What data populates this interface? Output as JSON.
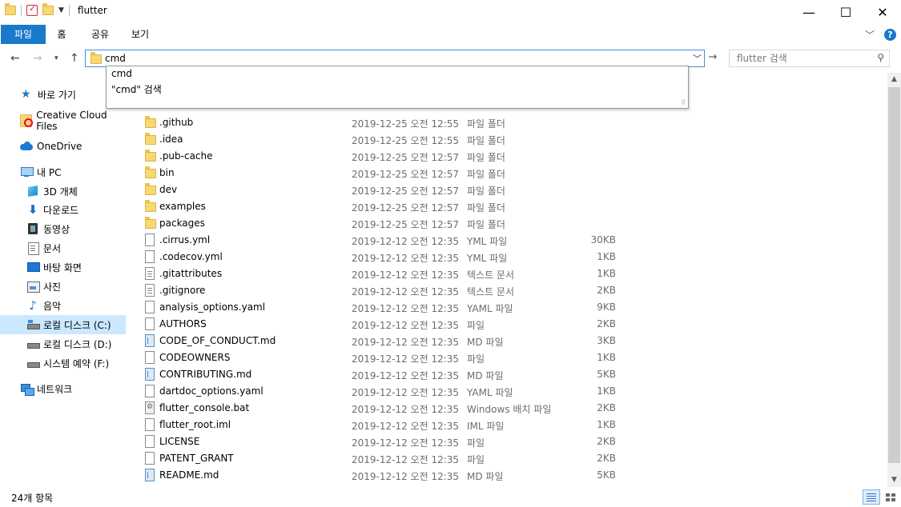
{
  "window": {
    "title": "flutter",
    "minimize_glyph": "—",
    "maximize_glyph": "☐",
    "close_glyph": "✕"
  },
  "ribbon": {
    "tabs": [
      "파일",
      "홈",
      "공유",
      "보기"
    ],
    "help_glyph": "?"
  },
  "address": {
    "value": "cmd",
    "go_glyph": "→"
  },
  "search": {
    "placeholder": "flutter 검색"
  },
  "suggestions": [
    "cmd",
    "\"cmd\" 검색"
  ],
  "nav": {
    "quick_access": "바로 가기",
    "creative_cloud": "Creative Cloud Files",
    "onedrive": "OneDrive",
    "this_pc": "내 PC",
    "objects3d": "3D 개체",
    "downloads": "다운로드",
    "videos": "동영상",
    "documents": "문서",
    "desktop": "바탕 화면",
    "pictures": "사진",
    "music": "음악",
    "drive_c": "로컬 디스크 (C:)",
    "drive_d": "로컬 디스크 (D:)",
    "drive_f": "시스템 예약 (F:)",
    "network": "네트워크"
  },
  "files": [
    {
      "name": ".github",
      "date": "2019-12-25 오전 12:55",
      "type": "파일 폴더",
      "size": "",
      "icon": "folder"
    },
    {
      "name": ".idea",
      "date": "2019-12-25 오전 12:55",
      "type": "파일 폴더",
      "size": "",
      "icon": "folder"
    },
    {
      "name": ".pub-cache",
      "date": "2019-12-25 오전 12:57",
      "type": "파일 폴더",
      "size": "",
      "icon": "folder"
    },
    {
      "name": "bin",
      "date": "2019-12-25 오전 12:57",
      "type": "파일 폴더",
      "size": "",
      "icon": "folder"
    },
    {
      "name": "dev",
      "date": "2019-12-25 오전 12:57",
      "type": "파일 폴더",
      "size": "",
      "icon": "folder"
    },
    {
      "name": "examples",
      "date": "2019-12-25 오전 12:57",
      "type": "파일 폴더",
      "size": "",
      "icon": "folder"
    },
    {
      "name": "packages",
      "date": "2019-12-25 오전 12:57",
      "type": "파일 폴더",
      "size": "",
      "icon": "folder"
    },
    {
      "name": ".cirrus.yml",
      "date": "2019-12-12 오전 12:35",
      "type": "YML 파일",
      "size": "30KB",
      "icon": "file"
    },
    {
      "name": ".codecov.yml",
      "date": "2019-12-12 오전 12:35",
      "type": "YML 파일",
      "size": "1KB",
      "icon": "file"
    },
    {
      "name": ".gitattributes",
      "date": "2019-12-12 오전 12:35",
      "type": "텍스트 문서",
      "size": "1KB",
      "icon": "text"
    },
    {
      "name": ".gitignore",
      "date": "2019-12-12 오전 12:35",
      "type": "텍스트 문서",
      "size": "2KB",
      "icon": "text"
    },
    {
      "name": "analysis_options.yaml",
      "date": "2019-12-12 오전 12:35",
      "type": "YAML 파일",
      "size": "9KB",
      "icon": "file"
    },
    {
      "name": "AUTHORS",
      "date": "2019-12-12 오전 12:35",
      "type": "파일",
      "size": "2KB",
      "icon": "file"
    },
    {
      "name": "CODE_OF_CONDUCT.md",
      "date": "2019-12-12 오전 12:35",
      "type": "MD 파일",
      "size": "3KB",
      "icon": "md"
    },
    {
      "name": "CODEOWNERS",
      "date": "2019-12-12 오전 12:35",
      "type": "파일",
      "size": "1KB",
      "icon": "file"
    },
    {
      "name": "CONTRIBUTING.md",
      "date": "2019-12-12 오전 12:35",
      "type": "MD 파일",
      "size": "5KB",
      "icon": "md"
    },
    {
      "name": "dartdoc_options.yaml",
      "date": "2019-12-12 오전 12:35",
      "type": "YAML 파일",
      "size": "1KB",
      "icon": "file"
    },
    {
      "name": "flutter_console.bat",
      "date": "2019-12-12 오전 12:35",
      "type": "Windows 배치 파일",
      "size": "2KB",
      "icon": "bat"
    },
    {
      "name": "flutter_root.iml",
      "date": "2019-12-12 오전 12:35",
      "type": "IML 파일",
      "size": "1KB",
      "icon": "file"
    },
    {
      "name": "LICENSE",
      "date": "2019-12-12 오전 12:35",
      "type": "파일",
      "size": "2KB",
      "icon": "file"
    },
    {
      "name": "PATENT_GRANT",
      "date": "2019-12-12 오전 12:35",
      "type": "파일",
      "size": "2KB",
      "icon": "file"
    },
    {
      "name": "README.md",
      "date": "2019-12-12 오전 12:35",
      "type": "MD 파일",
      "size": "5KB",
      "icon": "md"
    }
  ],
  "status": {
    "item_count": "24개 항목"
  },
  "colors": {
    "accent": "#1979ca",
    "selection": "#cce8ff",
    "address_border": "#3f8ee0"
  }
}
